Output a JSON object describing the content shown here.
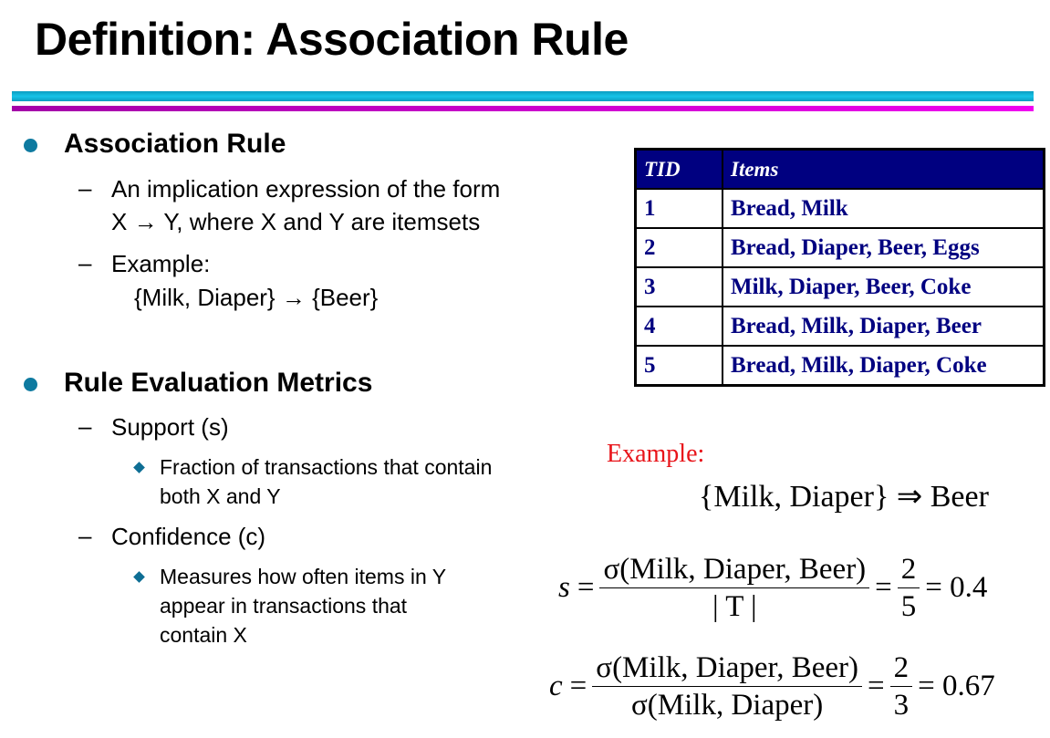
{
  "title": "Definition: Association Rule",
  "bullets": [
    {
      "heading": "Association Rule",
      "items": [
        {
          "lines": [
            "An implication expression of the form",
            "X → Y, where X and Y are itemsets"
          ]
        },
        {
          "lines": [
            "Example:",
            "{Milk, Diaper} → {Beer}"
          ]
        }
      ]
    },
    {
      "heading": "Rule Evaluation Metrics",
      "items": [
        {
          "lines": [
            "Support (s)"
          ],
          "sub": [
            "Fraction of transactions that contain",
            "both X and Y"
          ]
        },
        {
          "lines": [
            "Confidence (c)"
          ],
          "sub": [
            "Measures how often items in Y",
            "appear in transactions that",
            "contain X"
          ]
        }
      ]
    }
  ],
  "table": {
    "headers": [
      "TID",
      "Items"
    ],
    "rows": [
      [
        "1",
        "Bread, Milk"
      ],
      [
        "2",
        "Bread, Diaper, Beer, Eggs"
      ],
      [
        "3",
        "Milk, Diaper, Beer, Coke"
      ],
      [
        "4",
        "Bread, Milk, Diaper, Beer"
      ],
      [
        "5",
        "Bread, Milk, Diaper, Coke"
      ]
    ]
  },
  "example": {
    "label": "Example:",
    "rule": "{Milk, Diaper} ⇒ Beer",
    "support": {
      "var": "s",
      "eq": "=",
      "num": "σ(Milk, Diaper, Beer)",
      "den": "| T |",
      "eq2": "=",
      "fnum": "2",
      "fden": "5",
      "result": "= 0.4"
    },
    "confidence": {
      "var": "c",
      "eq": "=",
      "num": "σ(Milk, Diaper, Beer)",
      "den": "σ(Milk, Diaper)",
      "eq2": "=",
      "fnum": "2",
      "fden": "3",
      "result": "= 0.67"
    }
  },
  "colors": {
    "accent_cyan": "#16c3e8",
    "accent_magenta": "#e000e8",
    "table_navy": "#000080",
    "example_red": "#e8141a"
  }
}
